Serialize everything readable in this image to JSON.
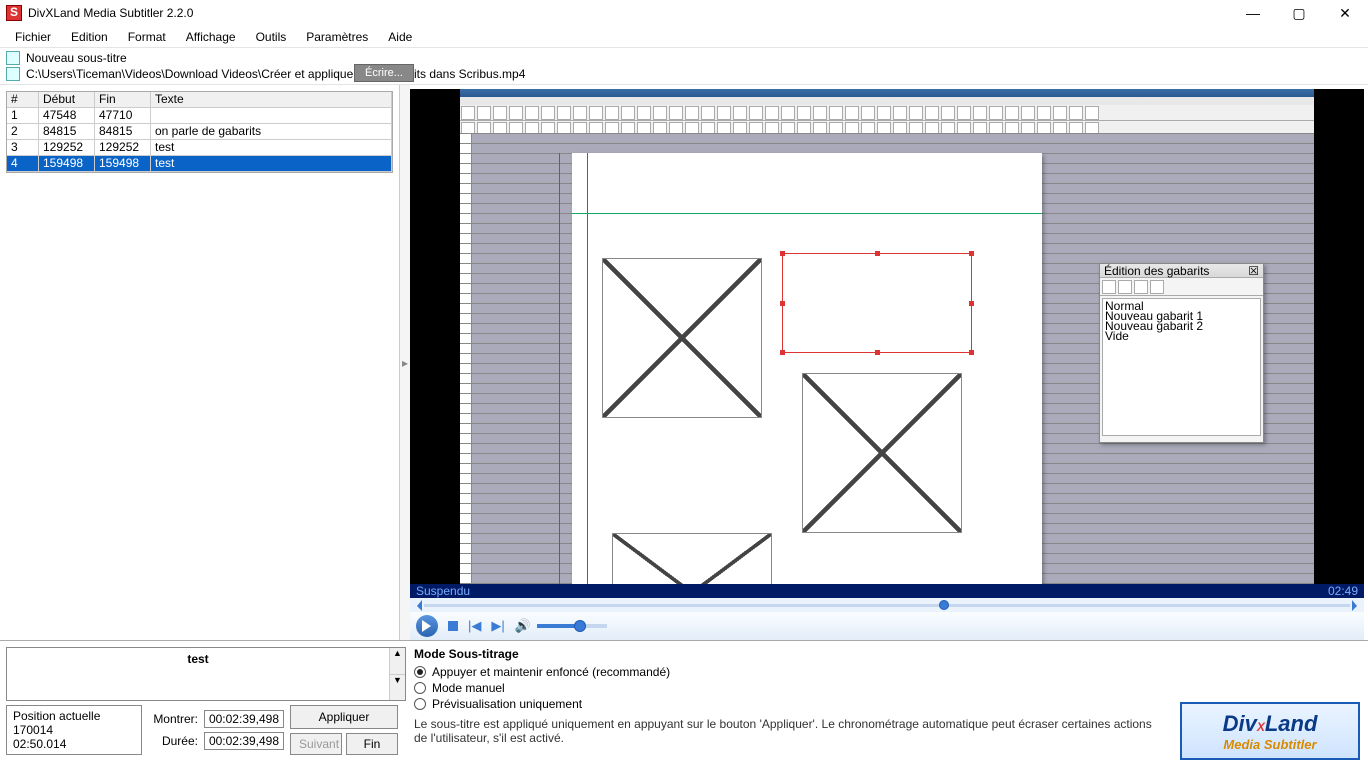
{
  "title": "DivXLand Media Subtitler 2.2.0",
  "menus": [
    "Fichier",
    "Edition",
    "Format",
    "Affichage",
    "Outils",
    "Paramètres",
    "Aide"
  ],
  "files": {
    "new": "Nouveau sous-titre",
    "path": "C:\\Users\\Ticeman\\Videos\\Download Videos\\Créer et appliquer des gabarits dans Scribus.mp4"
  },
  "overlay_hint": "Écrire...",
  "table": {
    "headers": [
      "#",
      "Début",
      "Fin",
      "Texte"
    ],
    "rows": [
      {
        "n": "1",
        "d": "47548",
        "f": "47710",
        "t": ""
      },
      {
        "n": "2",
        "d": "84815",
        "f": "84815",
        "t": "on parle de gabarits"
      },
      {
        "n": "3",
        "d": "129252",
        "f": "129252",
        "t": "test"
      },
      {
        "n": "4",
        "d": "159498",
        "f": "159498",
        "t": "test"
      }
    ],
    "selected": 3
  },
  "video": {
    "status": "Suspendu",
    "duration": "02:49",
    "seek_percent": 56,
    "volume_percent": 62
  },
  "scribus_panel": {
    "title": "Édition des gabarits",
    "items": [
      "Normal",
      "Nouveau gabarit 1",
      "Nouveau gabarit 2",
      "Vide"
    ]
  },
  "editor": {
    "text": "test",
    "position_label": "Position actuelle",
    "position_value": "170014",
    "duration_total": "02:50.014",
    "show_label": "Montrer:",
    "show_value": "00:02:39,498",
    "dur_label": "Durée:",
    "dur_value": "00:02:39,498",
    "apply": "Appliquer",
    "next": "Suivant",
    "end": "Fin"
  },
  "mode": {
    "title": "Mode Sous-titrage",
    "opts": [
      "Appuyer et maintenir enfoncé (recommandé)",
      "Mode manuel",
      "Prévisualisation uniquement"
    ],
    "selected": 0,
    "desc": "Le sous-titre est appliqué uniquement en appuyant sur le bouton 'Appliquer'. Le chronométrage automatique peut écraser certaines actions de l'utilisateur, s'il est activé."
  },
  "logo": {
    "brand": "DivXLand",
    "sub": "Media Subtitler"
  }
}
